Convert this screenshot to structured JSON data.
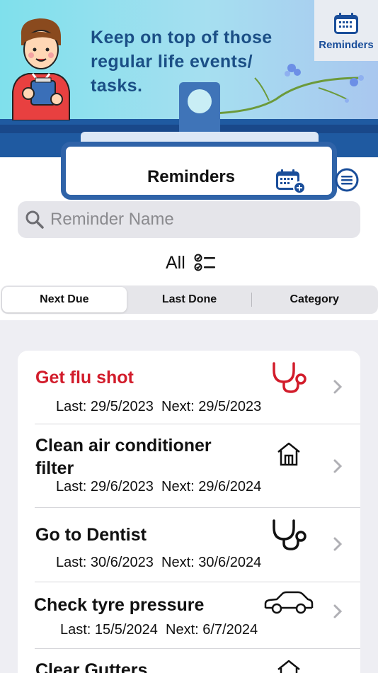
{
  "banner": {
    "tagline_line1": "Keep on top of those",
    "tagline_line2": "regular life events/",
    "tagline_line3": "tasks.",
    "badge_label": "Reminders",
    "badge_icon": "calendar-icon"
  },
  "header": {
    "title": "Reminders",
    "add_icon": "calendar-add-icon",
    "menu_icon": "menu-icon"
  },
  "search": {
    "placeholder": "Reminder Name",
    "value": ""
  },
  "filter": {
    "label": "All",
    "icon": "checklist-icon"
  },
  "sort_tabs": [
    {
      "label": "Next Due",
      "selected": true
    },
    {
      "label": "Last Done",
      "selected": false
    },
    {
      "label": "Category",
      "selected": false
    }
  ],
  "reminders": [
    {
      "name": "Get flu shot",
      "last": "Last: 29/5/2023",
      "next": "Next: 29/5/2023",
      "category_icon": "stethoscope-icon",
      "overdue": true
    },
    {
      "name_line1": "Clean air conditioner",
      "name_line2": "filter",
      "last": "Last: 29/6/2023",
      "next": "Next: 29/6/2024",
      "category_icon": "house-icon",
      "overdue": false
    },
    {
      "name": "Go to Dentist",
      "last": "Last: 30/6/2023",
      "next": "Next: 30/6/2024",
      "category_icon": "stethoscope-icon",
      "overdue": false
    },
    {
      "name": "Check tyre pressure",
      "last": "Last: 15/5/2024",
      "next": "Next: 6/7/2024",
      "category_icon": "car-icon",
      "overdue": false
    },
    {
      "name": "Clear Gutters",
      "category_icon": "house-icon",
      "overdue": false
    }
  ],
  "colors": {
    "accent_blue": "#2f63a8",
    "overdue_red": "#d21c2b",
    "list_background": "#eeeef3"
  }
}
